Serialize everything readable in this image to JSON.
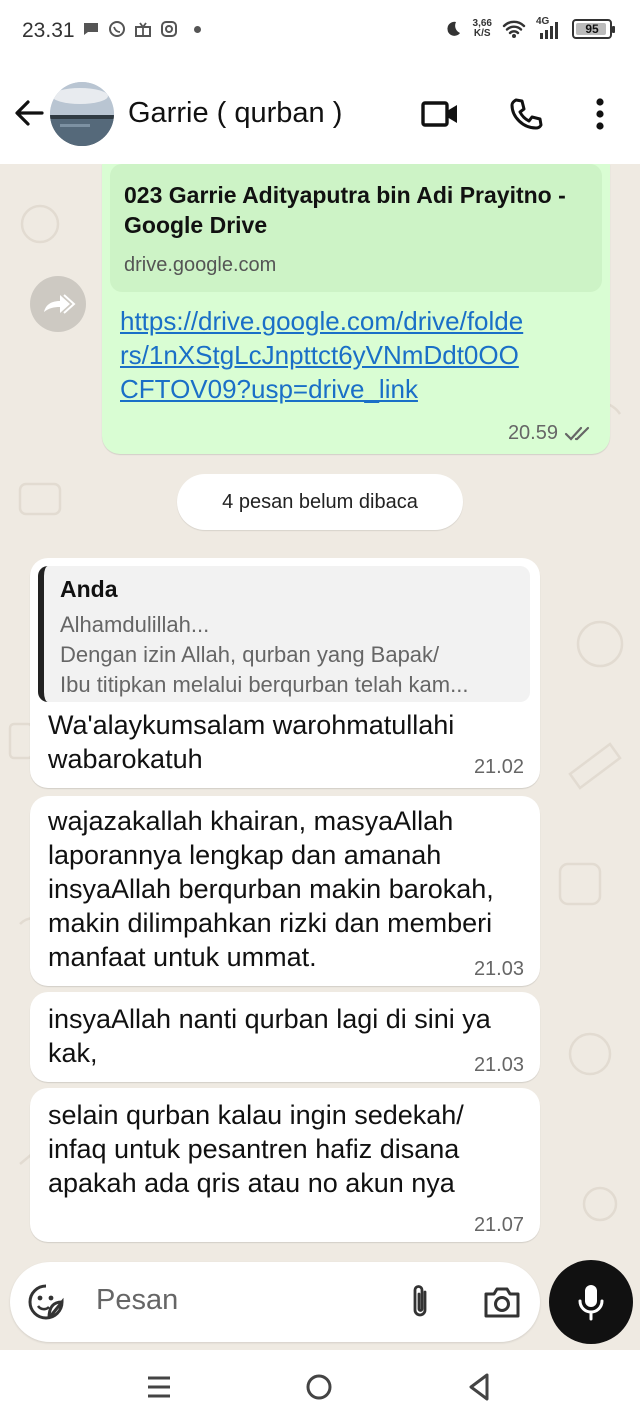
{
  "status_bar": {
    "time": "23.31",
    "speed_value": "3,66",
    "speed_unit": "K/S",
    "network": "4G",
    "battery": "95",
    "battery_level": 0.95
  },
  "header": {
    "contact_name": "Garrie ( qurban )"
  },
  "messages": {
    "outgoing_link": {
      "preview_title": "023 Garrie Adityaputra bin Adi Prayitno - Google Drive",
      "preview_domain": "drive.google.com",
      "link": "https://drive.google.com/drive/folders/1nXStgLcJnpttct6yVNmDdt0OOCFTOV09?usp=drive_link",
      "time": "20.59"
    },
    "unread_label": "4 pesan belum dibaca",
    "reply": {
      "quote_author": "Anda",
      "quote_line1": "Alhamdulillah...",
      "quote_line2": "Dengan izin Allah, qurban yang Bapak/",
      "quote_line3": "Ibu titipkan melalui berqurban telah kam...",
      "text": "Wa'alaykumsalam warohmatullahi wabarokatuh",
      "time": "21.02"
    },
    "msg2": {
      "text": "wajazakallah khairan, masyaAllah laporannya lengkap dan amanah insyaAllah berqurban makin barokah, makin dilimpahkan rizki dan memberi manfaat untuk ummat.",
      "time": "21.03"
    },
    "msg3": {
      "text": "insyaAllah nanti qurban lagi di sini ya kak,",
      "time": "21.03"
    },
    "msg4": {
      "text": "selain qurban kalau ingin sedekah/ infaq untuk pesantren hafiz disana apakah ada qris atau no akun nya",
      "time": "21.07"
    }
  },
  "input": {
    "placeholder": "Pesan"
  },
  "colors": {
    "outgoing_bubble": "#d9fdd3",
    "chat_background": "#efeae2",
    "link": "#1a6fc7"
  }
}
